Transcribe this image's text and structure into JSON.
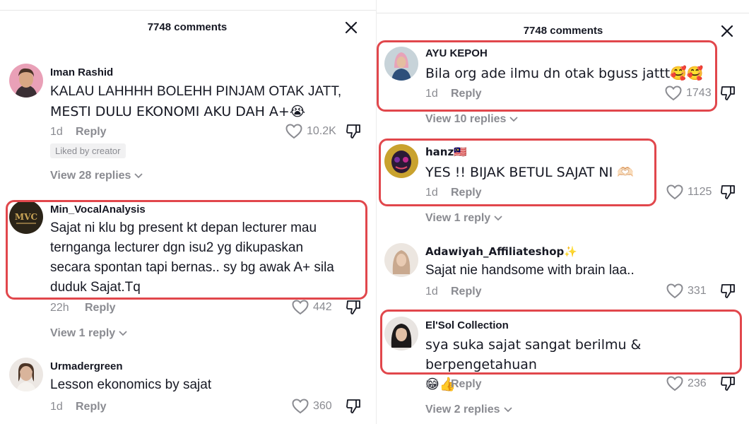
{
  "left": {
    "header": {
      "title": "7748 comments"
    },
    "comments": [
      {
        "username": "Iman Rashid",
        "lines": [
          "KALAU LAHHHH BOLEHH PINJAM OTAK JATT,",
          "MESTI DULU EKONOMI AKU DAH A+😭"
        ],
        "time": "1d",
        "reply": "Reply",
        "likes": "10.2K",
        "badge": "Liked by creator",
        "view_replies": "View 28 replies"
      },
      {
        "username": "Min_VocalAnalysis",
        "lines": [
          "Sajat ni klu bg present kt depan lecturer mau",
          "ternganga lecturer dgn isu2 yg dikupaskan",
          "secara spontan tapi bernas.. sy bg awak A+ sila",
          "duduk Sajat.Tq"
        ],
        "time": "22h",
        "reply": "Reply",
        "likes": "442",
        "view_replies": "View 1 reply"
      },
      {
        "username": "Urmadergreen",
        "lines": [
          "Lesson ekonomics by sajat"
        ],
        "time": "1d",
        "reply": "Reply",
        "likes": "360"
      }
    ]
  },
  "right": {
    "header": {
      "title": "7748 comments"
    },
    "comments": [
      {
        "username": "AYU KEPOH",
        "lines": [
          "Bila org ade ilmu dn otak bguss jattt🥰🥰"
        ],
        "time": "1d",
        "reply": "Reply",
        "likes": "1743",
        "view_replies": "View 10 replies"
      },
      {
        "username": "hanz🇲🇾",
        "lines": [
          "YES !! BIJAK BETUL SAJAT NI 🫶🏻"
        ],
        "time": "1d",
        "reply": "Reply",
        "likes": "1125",
        "view_replies": "View 1 reply"
      },
      {
        "username": "Adawiyah_Affiliateshop✨",
        "lines": [
          "Sajat nie handsome with brain laa.."
        ],
        "time": "1d",
        "reply": "Reply",
        "likes": "331"
      },
      {
        "username": "El'Sol Collection",
        "lines": [
          "sya suka sajat sangat berilmu & berpengetahuan",
          "😁👍"
        ],
        "time": "1d",
        "reply": "Reply",
        "likes": "236",
        "view_replies": "View 2 replies"
      }
    ]
  },
  "icons": {
    "close": "close-icon",
    "like": "heart-outline-icon",
    "dislike": "thumbs-down-icon",
    "chevron": "chevron-down-icon"
  },
  "colors": {
    "highlight": "#e1474c",
    "muted": "#8a8b91",
    "text": "#161823"
  }
}
